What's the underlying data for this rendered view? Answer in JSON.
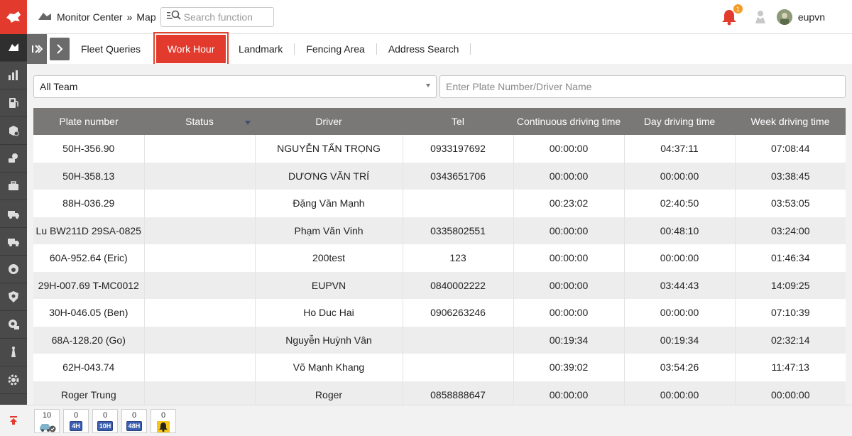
{
  "header": {
    "breadcrumb_module": "Monitor Center",
    "breadcrumb_separator": "»",
    "breadcrumb_page": "Map",
    "search_placeholder": "Search function",
    "notification_count": "1",
    "username": "eupvn"
  },
  "rail": {
    "items": [
      "map-icon",
      "chart-icon",
      "fuel-icon",
      "report-icon",
      "driver-icon",
      "briefcase-icon",
      "truck-icon",
      "truck-alert-icon",
      "dashboard-icon",
      "shield-icon",
      "gear-icon-2",
      "tower-icon",
      "settings-icon"
    ],
    "accent_color": "#e23b2e"
  },
  "tabs": {
    "items": [
      {
        "label": "Fleet Queries",
        "active": false
      },
      {
        "label": "Work Hour",
        "active": true
      },
      {
        "label": "Landmark",
        "active": false
      },
      {
        "label": "Fencing Area",
        "active": false
      },
      {
        "label": "Address Search",
        "active": false
      }
    ]
  },
  "filters": {
    "team_selected": "All Team",
    "plate_placeholder": "Enter Plate Number/Driver Name"
  },
  "table": {
    "columns": [
      "Plate number",
      "Status",
      "Driver",
      "Tel",
      "Continuous driving time",
      "Day driving time",
      "Week driving time"
    ],
    "rows": [
      [
        "50H-356.90",
        "",
        "NGUYỄN TẤN TRỌNG",
        "0933197692",
        "00:00:00",
        "04:37:11",
        "07:08:44"
      ],
      [
        "50H-358.13",
        "",
        "DƯƠNG VĂN TRÍ",
        "0343651706",
        "00:00:00",
        "00:00:00",
        "03:38:45"
      ],
      [
        "88H-036.29",
        "",
        "Đặng Văn Mạnh",
        "",
        "00:23:02",
        "02:40:50",
        "03:53:05"
      ],
      [
        "Lu BW211D 29SA-0825",
        "",
        "Phạm Văn Vinh",
        "0335802551",
        "00:00:00",
        "00:48:10",
        "03:24:00"
      ],
      [
        "60A-952.64 (Eric)",
        "",
        "200test",
        "123",
        "00:00:00",
        "00:00:00",
        "01:46:34"
      ],
      [
        "29H-007.69 T-MC0012",
        "",
        "EUPVN",
        "0840002222",
        "00:00:00",
        "03:44:43",
        "14:09:25"
      ],
      [
        "30H-046.05 (Ben)",
        "",
        "Ho Duc Hai",
        "0906263246",
        "00:00:00",
        "00:00:00",
        "07:10:39"
      ],
      [
        "68A-128.20 (Go)",
        "",
        "Nguyễn Huỳnh Vân",
        "",
        "00:19:34",
        "00:19:34",
        "02:32:14"
      ],
      [
        "62H-043.74",
        "",
        "Võ Mạnh Khang",
        "",
        "00:39:02",
        "03:54:26",
        "11:47:13"
      ],
      [
        "Roger   Trung",
        "",
        "Roger",
        "0858888647",
        "00:00:00",
        "00:00:00",
        "00:00:00"
      ]
    ]
  },
  "statusbar": {
    "items": [
      {
        "count": "10",
        "icon": "car-check-icon"
      },
      {
        "count": "0",
        "label": "4H"
      },
      {
        "count": "0",
        "label": "10H"
      },
      {
        "count": "0",
        "label": "48H"
      },
      {
        "count": "0",
        "icon": "alarm-bell-icon"
      }
    ]
  }
}
